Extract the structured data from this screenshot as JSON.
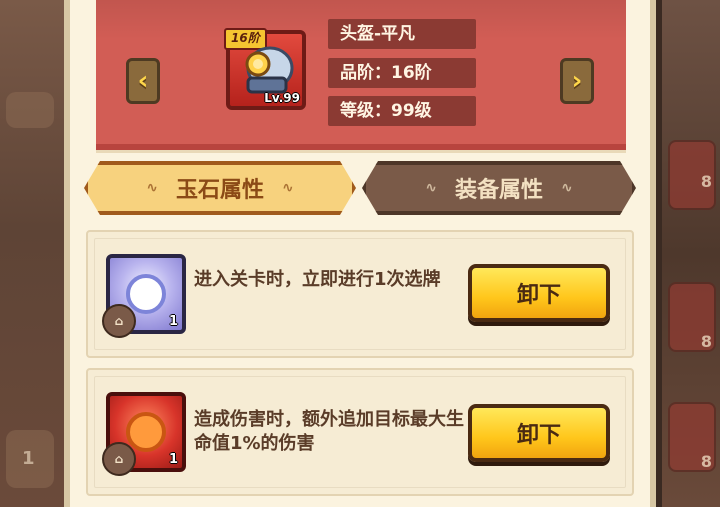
{
  "item": {
    "name": "头盔-平凡",
    "grade": "品阶：16阶",
    "level": "等级：99级",
    "tier_badge": "16阶",
    "level_badge": "Lv.99"
  },
  "tabs": [
    {
      "label": "玉石属性",
      "active": true
    },
    {
      "label": "装备属性",
      "active": false
    }
  ],
  "cards": [
    {
      "gem": "purple",
      "qty": "1",
      "desc": "进入关卡时，立即进行1次选牌",
      "button": "卸下"
    },
    {
      "gem": "red",
      "qty": "1",
      "desc": "造成伤害时，额外追加目标最大生命值1%的伤害",
      "button": "卸下"
    }
  ],
  "bg_right_numbers": [
    "8",
    "8",
    "8"
  ],
  "bg_left_number": "1",
  "colors": {
    "header_red": "#d25d55",
    "info_bar": "#8b3a33",
    "tab_active": "#f7d27e",
    "tab_inactive": "#7a5a48",
    "button_yellow": "#ffc61b"
  },
  "icons": {
    "prev": "chevron-left-icon",
    "next": "chevron-right-icon"
  }
}
